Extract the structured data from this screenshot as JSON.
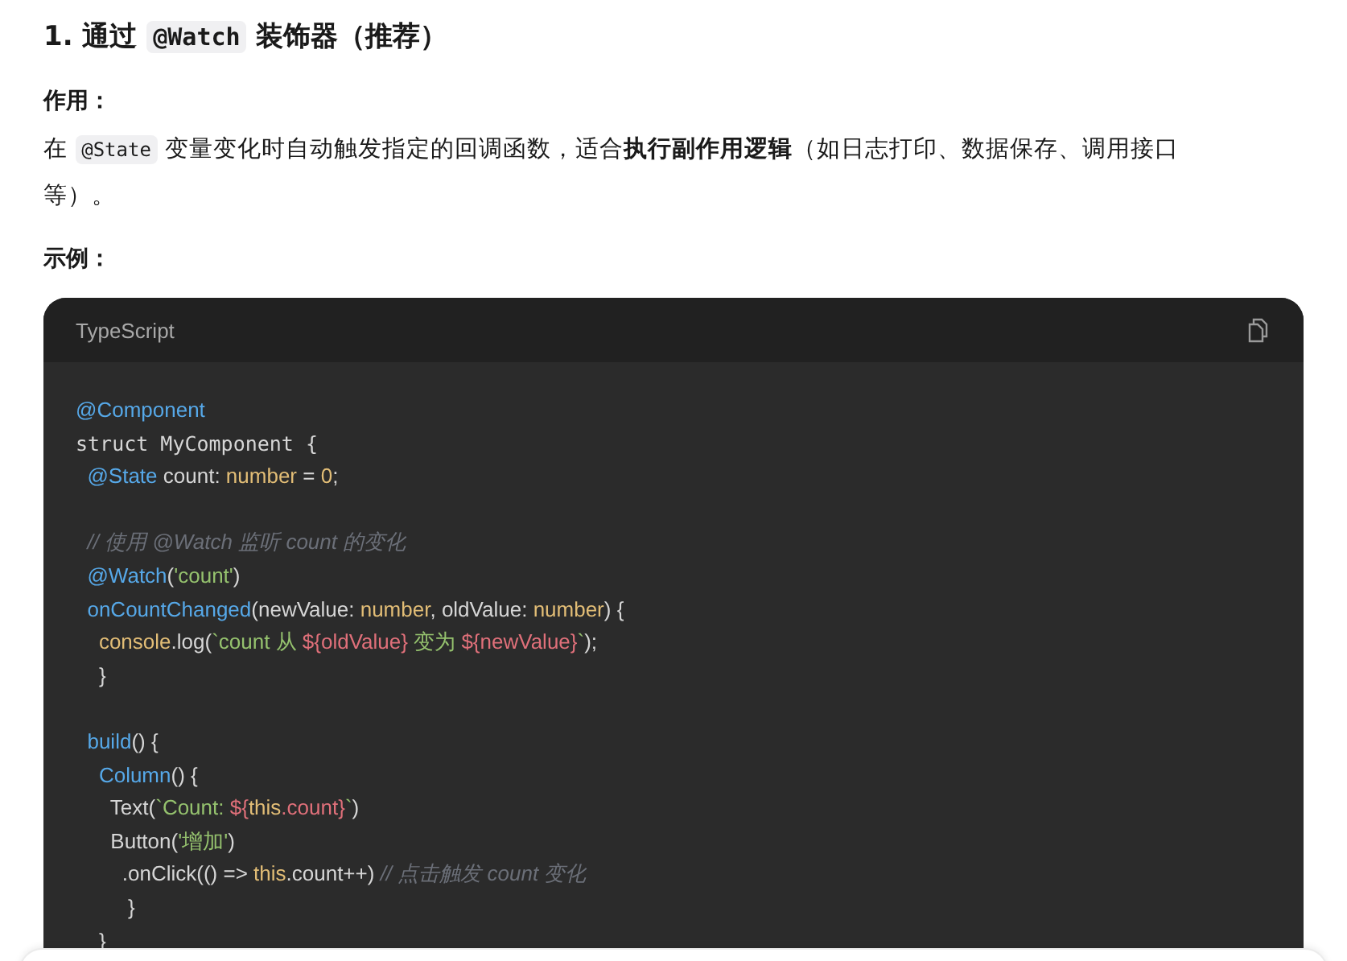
{
  "heading": {
    "number": "1.",
    "before": "通过",
    "code": "@Watch",
    "after": "装饰器（推荐）"
  },
  "purpose_label": "作用：",
  "purpose": [
    {
      "kind": "text",
      "text": "在 "
    },
    {
      "kind": "code",
      "text": "@State"
    },
    {
      "kind": "text",
      "text": " 变量变化时自动触发指定的回调函数，适合**执行副作用逻辑**（如日志打印、数据保存、调用接口等）。"
    }
  ],
  "example_label": "示例：",
  "code_block": {
    "language": "TypeScript",
    "lines": [
      [
        {
          "kind": "decorator",
          "text": "@Component"
        }
      ],
      [
        {
          "kind": "mono",
          "text": "struct MyComponent {"
        }
      ],
      [
        {
          "kind": "decorator",
          "text": "  @State"
        },
        {
          "kind": "plain",
          "text": " count: "
        },
        {
          "kind": "type",
          "text": "number"
        },
        {
          "kind": "plain",
          "text": " = "
        },
        {
          "kind": "type",
          "text": "0"
        },
        {
          "kind": "plain",
          "text": ";"
        }
      ],
      [
        {
          "kind": "comment",
          "gap_before": true,
          "text": "  // 使用 @Watch 监听 count 的变化"
        }
      ],
      [
        {
          "kind": "decorator",
          "text": "  @Watch"
        },
        {
          "kind": "plain",
          "text": "("
        },
        {
          "kind": "string",
          "text": "'count'"
        },
        {
          "kind": "plain",
          "text": ")"
        }
      ],
      [
        {
          "kind": "decorator",
          "text": "  onCountChanged"
        },
        {
          "kind": "plain",
          "text": "(newValue: "
        },
        {
          "kind": "type",
          "text": "number"
        },
        {
          "kind": "plain",
          "text": ", oldValue: "
        },
        {
          "kind": "type",
          "text": "number"
        },
        {
          "kind": "plain",
          "text": ") {"
        }
      ],
      [
        {
          "kind": "type",
          "text": "    console"
        },
        {
          "kind": "plain",
          "text": ".log("
        },
        {
          "kind": "string",
          "text": "`count 从 "
        },
        {
          "kind": "interp",
          "text": "${oldValue}"
        },
        {
          "kind": "string",
          "text": " 变为 "
        },
        {
          "kind": "interp",
          "text": "${newValue}"
        },
        {
          "kind": "string",
          "text": "`"
        },
        {
          "kind": "plain",
          "text": ");"
        }
      ],
      [
        {
          "kind": "plain",
          "text": "    }"
        }
      ],
      [
        {
          "kind": "decorator",
          "gap_before": true,
          "text": "  build"
        },
        {
          "kind": "plain",
          "text": "() {"
        }
      ],
      [
        {
          "kind": "decorator",
          "text": "    Column"
        },
        {
          "kind": "plain",
          "text": "() {"
        }
      ],
      [
        {
          "kind": "plain",
          "text": "      Text("
        },
        {
          "kind": "string",
          "text": "`Count: "
        },
        {
          "kind": "interp",
          "text": "${"
        },
        {
          "kind": "type",
          "text": "this"
        },
        {
          "kind": "interp",
          "text": ".count}"
        },
        {
          "kind": "string",
          "text": "`"
        },
        {
          "kind": "plain",
          "text": ")"
        }
      ],
      [
        {
          "kind": "plain",
          "text": "      Button("
        },
        {
          "kind": "string",
          "text": "'增加'"
        },
        {
          "kind": "plain",
          "text": ")"
        }
      ],
      [
        {
          "kind": "plain",
          "text": "        .onClick(() => "
        },
        {
          "kind": "type",
          "text": "this"
        },
        {
          "kind": "plain",
          "text": ".count++) "
        },
        {
          "kind": "comment",
          "text": "// 点击触发 count 变化"
        }
      ],
      [
        {
          "kind": "plain",
          "text": "         }"
        }
      ],
      [
        {
          "kind": "plain",
          "text": "    }"
        }
      ]
    ]
  }
}
